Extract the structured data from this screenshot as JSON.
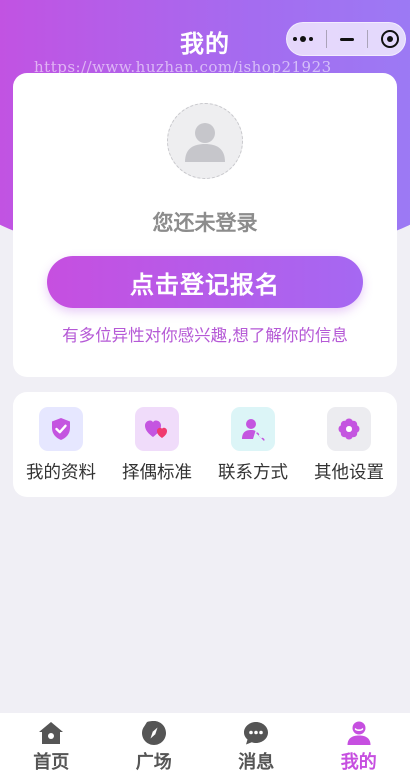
{
  "header": {
    "title": "我的"
  },
  "watermark": "https://www.huzhan.com/ishop21923",
  "colors": {
    "accent": "#c64fe0",
    "accent_end": "#a568f2",
    "interest_text": "#b559d6"
  },
  "profile": {
    "avatar_icon": "user-placeholder-icon",
    "login_hint": "您还未登录",
    "register_button": "点击登记报名",
    "interest_text": "有多位异性对你感兴趣,想了解你的信息"
  },
  "menu": [
    {
      "label": "我的资料",
      "icon": "shield-check-icon"
    },
    {
      "label": "择偶标准",
      "icon": "hearts-icon"
    },
    {
      "label": "联系方式",
      "icon": "contact-person-icon"
    },
    {
      "label": "其他设置",
      "icon": "flower-gear-icon"
    }
  ],
  "tabbar": [
    {
      "label": "首页",
      "icon": "home-icon",
      "active": false
    },
    {
      "label": "广场",
      "icon": "compass-icon",
      "active": false
    },
    {
      "label": "消息",
      "icon": "message-icon",
      "active": false
    },
    {
      "label": "我的",
      "icon": "user-icon",
      "active": true
    }
  ]
}
